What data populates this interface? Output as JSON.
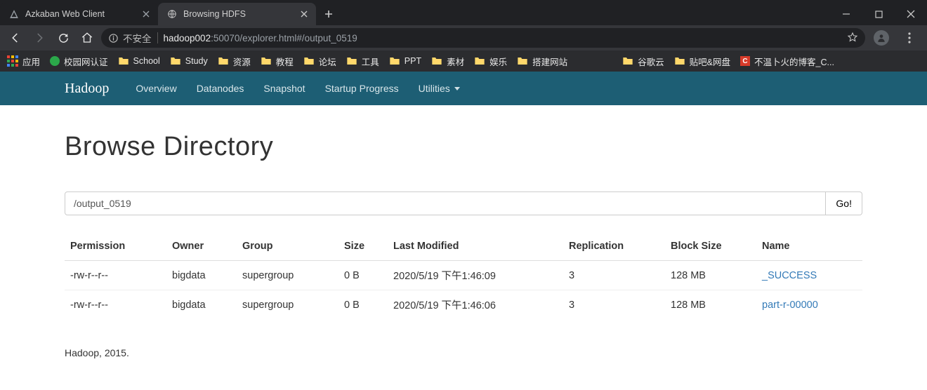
{
  "browser": {
    "tabs": [
      {
        "title": "Azkaban Web Client",
        "active": false
      },
      {
        "title": "Browsing HDFS",
        "active": true
      }
    ],
    "security_label": "不安全",
    "url_host": "hadoop002",
    "url_rest": ":50070/explorer.html#/output_0519",
    "bookmarks": {
      "apps": "应用",
      "items": [
        "校园网认证",
        "School",
        "Study",
        "资源",
        "教程",
        "论坛",
        "工具",
        "PPT",
        "素材",
        "娱乐",
        "搭建网站"
      ],
      "extra": [
        {
          "icon": "folder",
          "label": "谷歌云"
        },
        {
          "icon": "folder",
          "label": "贴吧&网盘"
        },
        {
          "icon": "red-c",
          "label": "不温卜火的博客_C..."
        }
      ]
    }
  },
  "hadoop_nav": {
    "brand": "Hadoop",
    "items": [
      "Overview",
      "Datanodes",
      "Snapshot",
      "Startup Progress"
    ],
    "utilities": "Utilities"
  },
  "page": {
    "title": "Browse Directory",
    "path_value": "/output_0519",
    "go_label": "Go!",
    "columns": [
      "Permission",
      "Owner",
      "Group",
      "Size",
      "Last Modified",
      "Replication",
      "Block Size",
      "Name"
    ],
    "rows": [
      {
        "permission": "-rw-r--r--",
        "owner": "bigdata",
        "group": "supergroup",
        "size": "0 B",
        "modified": "2020/5/19 下午1:46:09",
        "replication": "3",
        "block_size": "128 MB",
        "name": "_SUCCESS"
      },
      {
        "permission": "-rw-r--r--",
        "owner": "bigdata",
        "group": "supergroup",
        "size": "0 B",
        "modified": "2020/5/19 下午1:46:06",
        "replication": "3",
        "block_size": "128 MB",
        "name": "part-r-00000"
      }
    ],
    "footer": "Hadoop, 2015."
  }
}
